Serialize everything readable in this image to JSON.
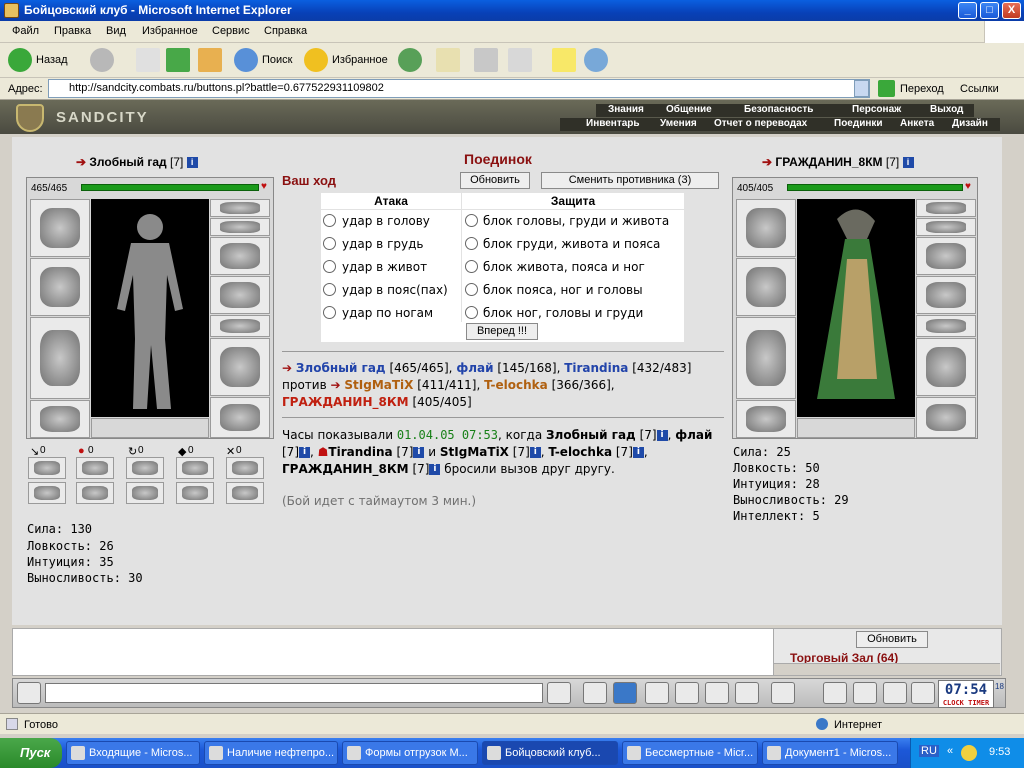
{
  "window": {
    "title": "Бойцовский клуб - Microsoft Internet Explorer",
    "buttons": [
      "_",
      "□",
      "X"
    ]
  },
  "menu": [
    "Файл",
    "Правка",
    "Вид",
    "Избранное",
    "Сервис",
    "Справка"
  ],
  "toolbar": {
    "back": "Назад",
    "search": "Поиск",
    "favorites": "Избранное"
  },
  "address": {
    "label": "Адрес:",
    "url": "http://sandcity.combats.ru/buttons.pl?battle=0.677522931109802",
    "go": "Переход",
    "links": "Ссылки"
  },
  "game": {
    "logo": "SANDCITY",
    "nav_top": [
      "Знания",
      "Общение",
      "Безопасность",
      "Персонаж",
      "Выход"
    ],
    "nav_bottom": [
      "Инвентарь",
      "Умения",
      "Отчет о переводах",
      "Поединки",
      "Анкета",
      "Дизайн"
    ]
  },
  "left_player": {
    "name": "Злобный гад",
    "level": "[7]",
    "hp": "465/465",
    "hp_fraction": 1.0,
    "counters": [
      "0",
      "0",
      "0",
      "0",
      "0"
    ],
    "stats": [
      "Сила: 130",
      "Ловкость: 26",
      "Интуиция: 35",
      "Выносливость: 30"
    ]
  },
  "right_player": {
    "name": "ГРАЖДАНИН_8КМ",
    "level": "[7]",
    "hp": "405/405",
    "hp_fraction": 1.0,
    "stats": [
      "Сила: 25",
      "Ловкость: 50",
      "Интуиция: 28",
      "Выносливость: 29",
      "Интеллект: 5"
    ]
  },
  "battle": {
    "title": "Поединок",
    "your_turn": "Ваш ход",
    "refresh": "Обновить",
    "change": "Сменить противника (3)",
    "attack_header": "Атака",
    "defense_header": "Защита",
    "attacks": [
      "удар в голову",
      "удар в грудь",
      "удар в живот",
      "удар в пояс(пах)",
      "удар по ногам"
    ],
    "defenses": [
      "блок головы, груди и живота",
      "блок груди, живота и пояса",
      "блок живота, пояса и ног",
      "блок пояса, ног и головы",
      "блок ног, головы и груди"
    ],
    "forward": "Вперед !!!"
  },
  "teams": {
    "t1": [
      {
        "name": "Злобный гад",
        "hp": "[465/465]"
      },
      {
        "name": "флай",
        "hp": "[145/168]"
      },
      {
        "name": "Tirandina",
        "hp": "[432/483]"
      }
    ],
    "vs": "против",
    "t2": [
      {
        "name": "StIgMaTiX",
        "hp": "[411/411]"
      },
      {
        "name": "T-elochka",
        "hp": "[366/366]"
      },
      {
        "name": "ГРАЖДАНИН_8КМ",
        "hp": "[405/405]"
      }
    ]
  },
  "log": {
    "clock_prefix": "Часы показывали",
    "datetime": "01.04.05 07:53",
    "when": ", когда",
    "p1": "Злобный гад",
    "p2": "флай",
    "p3": "Tirandina",
    "and": "и",
    "p4": "StIgMaTiX",
    "p5": "T-elochka",
    "p6": "ГРАЖДАНИН_8КМ",
    "lvl": "[7]",
    "suffix": "бросили вызов друг другу.",
    "timeout": "(Бой идет с таймаутом 3 мин.)"
  },
  "chat": {
    "refresh": "Обновить",
    "room": "Торговый Зал (64)",
    "clock": "07:54",
    "clock_sec": "18",
    "clock_label": "CLOCK",
    "timer_label": "TIMER"
  },
  "status": {
    "left": "Готово",
    "zone": "Интернет"
  },
  "taskbar": {
    "start": "Пуск",
    "tasks": [
      "Входящие - Micros...",
      "Наличие нефтепро...",
      "Формы отгрузок М...",
      "Бойцовский клуб...",
      "Бессмертные - Micr...",
      "Документ1 - Micros..."
    ],
    "lang": "RU",
    "time": "9:53"
  }
}
